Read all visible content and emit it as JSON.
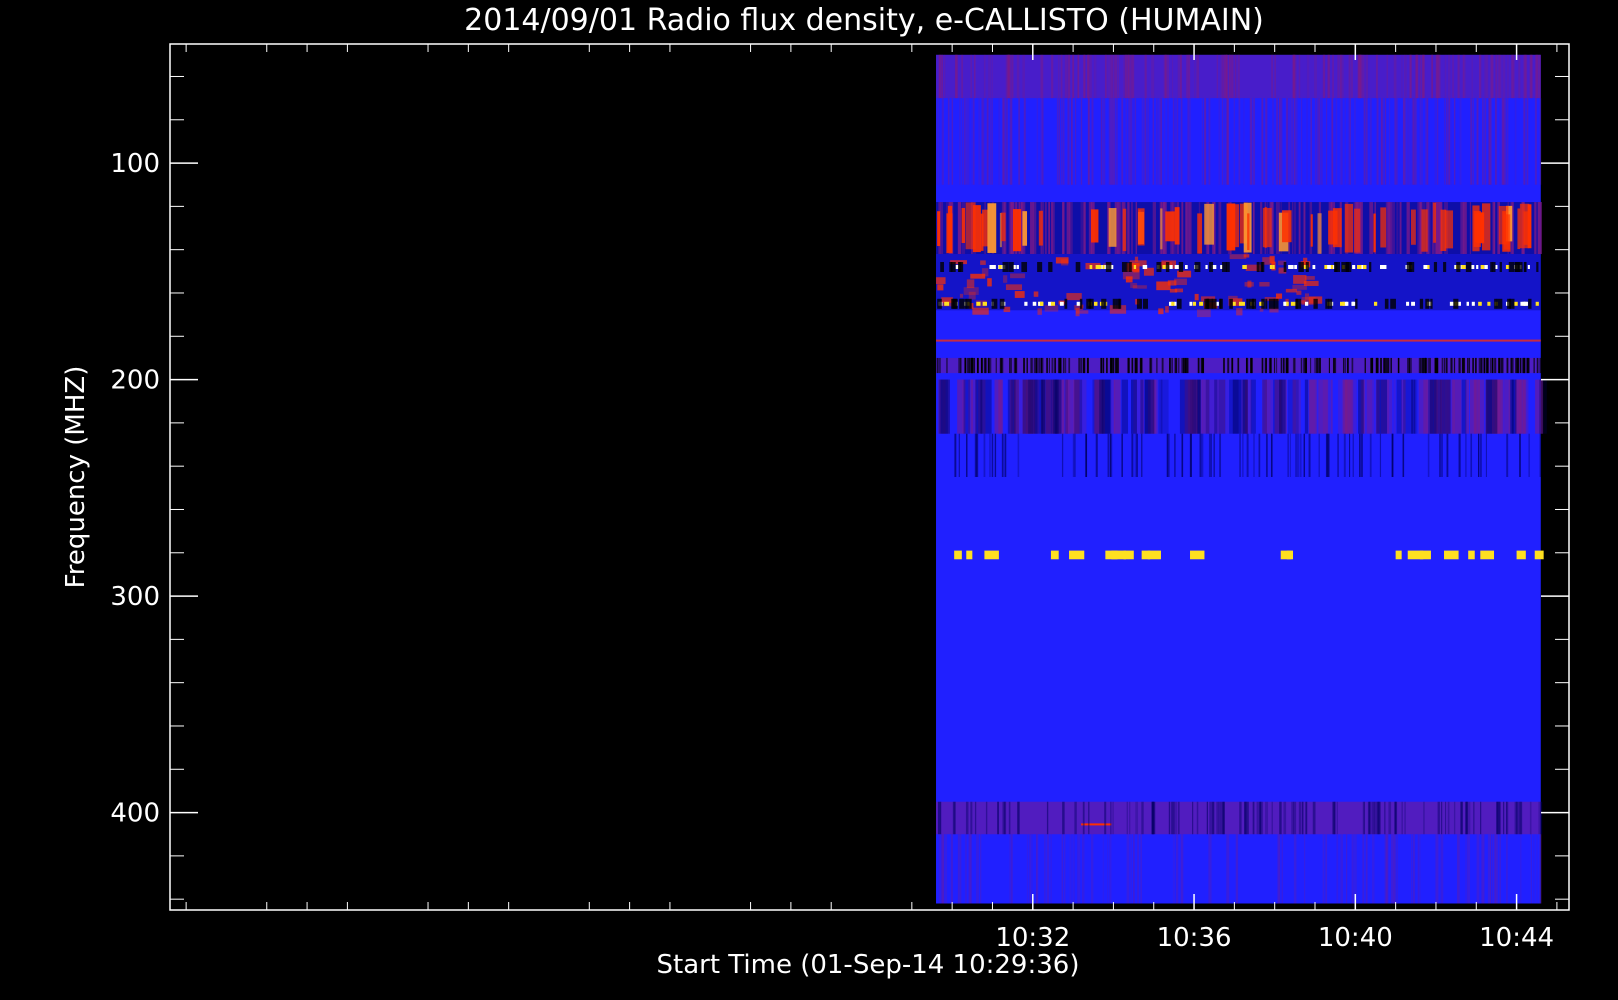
{
  "chart_data": {
    "type": "heatmap",
    "title": "2014/09/01  Radio flux density, e-CALLISTO (HUMAIN)",
    "xlabel": "Start Time (01-Sep-14 10:29:36)",
    "ylabel": "Frequency (MHZ)",
    "x_range_min": [
      10.6,
      45.3
    ],
    "y_range_mhz": [
      45,
      445
    ],
    "y_inverted": true,
    "x_ticks": [
      {
        "value": 32,
        "label": "10:32"
      },
      {
        "value": 36,
        "label": "10:36"
      },
      {
        "value": 40,
        "label": "10:40"
      },
      {
        "value": 44,
        "label": "10:44"
      }
    ],
    "y_ticks": [
      {
        "value": 100,
        "label": "100"
      },
      {
        "value": 200,
        "label": "200"
      },
      {
        "value": 300,
        "label": "300"
      },
      {
        "value": 400,
        "label": "400"
      }
    ],
    "data_extent_x_min": [
      29.6,
      44.6
    ],
    "data_extent_y_mhz": [
      50,
      442
    ],
    "colors": {
      "background": "#000000",
      "base": "#2020ff",
      "low": "#000060",
      "mid": "#7a1a8a",
      "high": "#ff3000",
      "peak": "#ffe020",
      "axis": "#ffffff"
    },
    "bands": [
      {
        "f0": 50,
        "f1": 70,
        "kind": "noisy-purple"
      },
      {
        "f0": 70,
        "f1": 110,
        "kind": "streaky-purple"
      },
      {
        "f0": 118,
        "f1": 142,
        "kind": "red-orange-bursts"
      },
      {
        "f0": 142,
        "f1": 168,
        "kind": "red-patches"
      },
      {
        "f0": 148,
        "f1": 148,
        "kind": "bright-dots-line"
      },
      {
        "f0": 165,
        "f1": 165,
        "kind": "bright-dots-line"
      },
      {
        "f0": 182,
        "f1": 182,
        "kind": "thin-red-line"
      },
      {
        "f0": 190,
        "f1": 197,
        "kind": "dark-stripes"
      },
      {
        "f0": 200,
        "f1": 225,
        "kind": "dim-purple"
      },
      {
        "f0": 225,
        "f1": 245,
        "kind": "sparse-dark-stripes"
      },
      {
        "f0": 279,
        "f1": 283,
        "kind": "yellow-dash-line"
      },
      {
        "f0": 395,
        "f1": 410,
        "kind": "purple-band"
      },
      {
        "f0": 410,
        "f1": 442,
        "kind": "faint-purple"
      }
    ]
  }
}
